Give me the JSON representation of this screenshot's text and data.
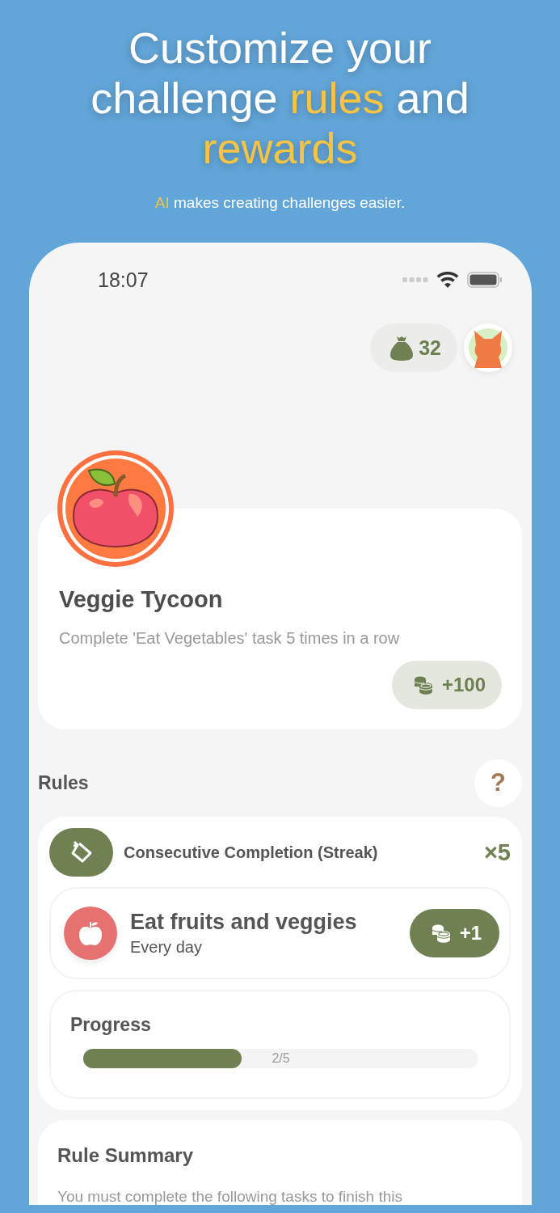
{
  "headline": {
    "lines": [
      [
        {
          "text": "Customize your",
          "highlight": false
        }
      ],
      [
        {
          "text": "challenge ",
          "highlight": false
        },
        {
          "text": "rules",
          "highlight": true
        },
        {
          "text": " and",
          "highlight": false
        }
      ],
      [
        {
          "text": "rewards",
          "highlight": true
        }
      ]
    ]
  },
  "subtitle": [
    {
      "text": "AI",
      "highlight": true
    },
    {
      "text": " makes creating challenges easier.",
      "highlight": false
    }
  ],
  "status_bar": {
    "time": "18:07"
  },
  "balance": "32",
  "challenge": {
    "title": "Veggie Tycoon",
    "description": "Complete 'Eat Vegetables' task 5 times in a row",
    "reward": "+100"
  },
  "rules": {
    "title": "Rules",
    "help": "?",
    "rule_type": "Consecutive Completion (Streak)",
    "multiplier": "×5",
    "task": {
      "name": "Eat fruits and veggies",
      "frequency": "Every day",
      "reward": "+1"
    },
    "progress": {
      "title": "Progress",
      "level": 0.4,
      "reading": "2/5"
    }
  },
  "summary": {
    "title": "Rule Summary",
    "text": "You must complete the following tasks to finish this"
  }
}
